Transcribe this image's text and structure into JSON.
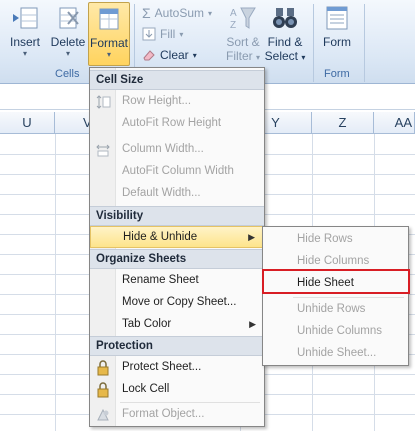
{
  "ribbon": {
    "insert_label": "Insert",
    "delete_label": "Delete",
    "format_label": "Format",
    "cells_group": "Cells",
    "autosum_label": "AutoSum",
    "fill_label": "Fill",
    "clear_label": "Clear",
    "sort_label": "Sort &",
    "filter_label": "Filter",
    "find_label": "Find &",
    "select_label": "Select",
    "form_label": "Form",
    "form_group": "Form"
  },
  "columns": [
    "U",
    "V",
    "Y",
    "Z",
    "AA"
  ],
  "format_menu": {
    "cell_size_header": "Cell Size",
    "row_height": "Row Height...",
    "autofit_row_height": "AutoFit Row Height",
    "column_width": "Column Width...",
    "autofit_column_width": "AutoFit Column Width",
    "default_width": "Default Width...",
    "visibility_header": "Visibility",
    "hide_unhide": "Hide & Unhide",
    "organize_header": "Organize Sheets",
    "rename_sheet": "Rename Sheet",
    "move_copy_sheet": "Move or Copy Sheet...",
    "tab_color": "Tab Color",
    "protection_header": "Protection",
    "protect_sheet": "Protect Sheet...",
    "lock_cell": "Lock Cell",
    "format_object": "Format Object..."
  },
  "hide_submenu": {
    "hide_rows": "Hide Rows",
    "hide_columns": "Hide Columns",
    "hide_sheet": "Hide Sheet",
    "unhide_rows": "Unhide Rows",
    "unhide_columns": "Unhide Columns",
    "unhide_sheet": "Unhide Sheet..."
  },
  "colors": {
    "highlight": "#fde48b",
    "callout": "#d81d24",
    "ribbon": "#dbe7f5"
  }
}
